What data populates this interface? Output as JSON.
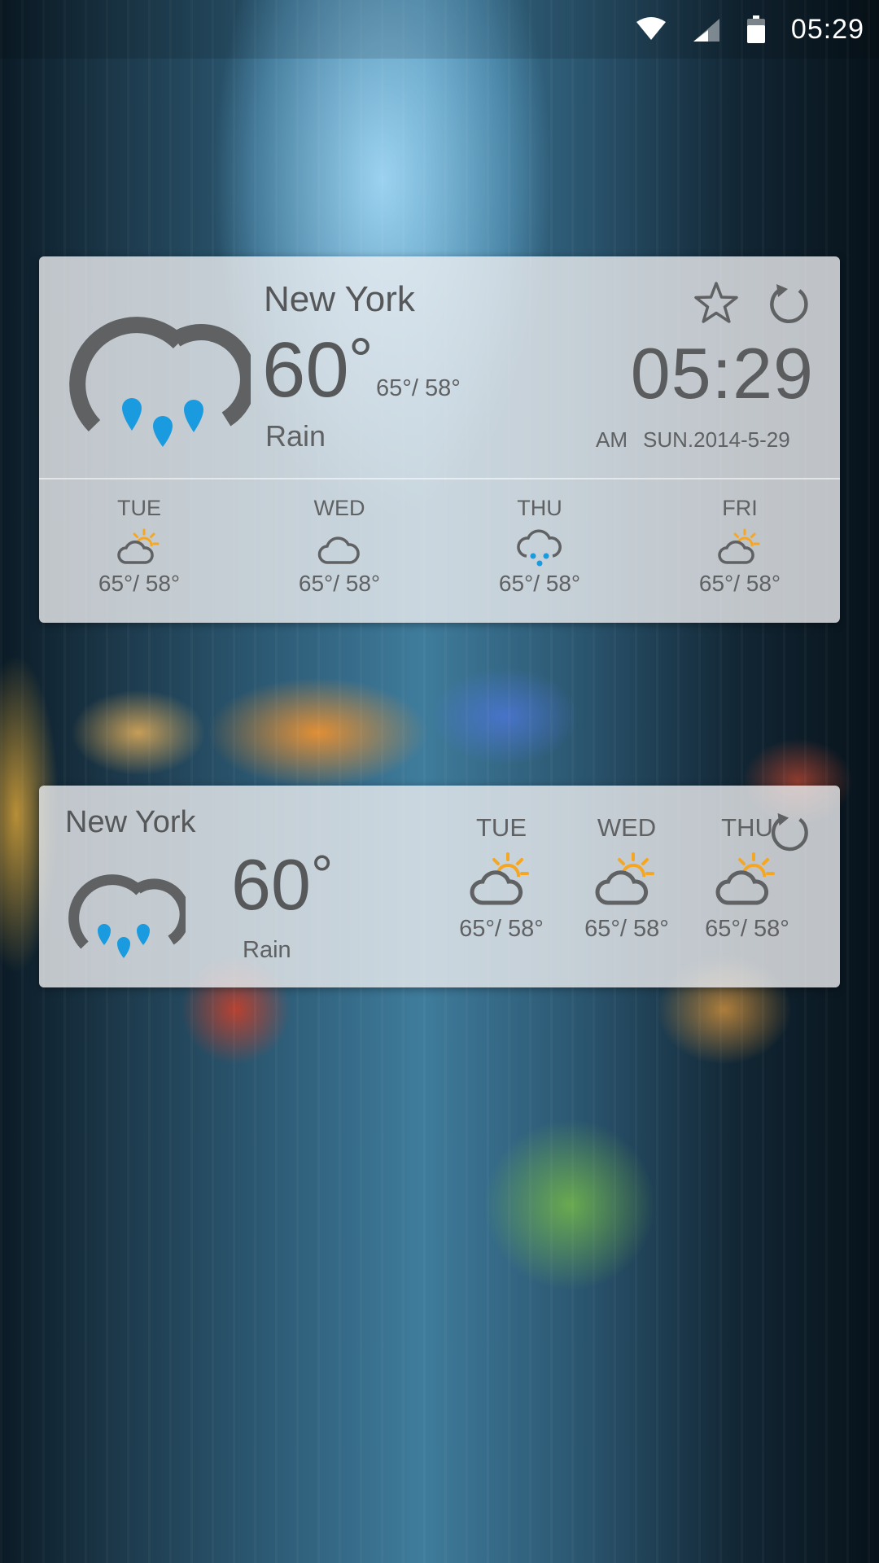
{
  "colors": {
    "text": "#5f6163",
    "icon_gray": "#5f6163",
    "rain_blue": "#1a9be0",
    "sun_yellow": "#f5a623",
    "panel": "rgba(236,238,240,0.80)"
  },
  "status_bar": {
    "time": "05:29",
    "icons": [
      "wifi-icon",
      "signal-icon",
      "battery-icon"
    ]
  },
  "large_widget": {
    "city": "New York",
    "temperature": "60",
    "degree": "°",
    "range": "65°/ 58°",
    "condition": "Rain",
    "condition_icon": "rain-cloud-icon",
    "time": "05:29",
    "ampm": "AM",
    "date": "SUN.2014-5-29",
    "actions": [
      "star-icon",
      "refresh-icon"
    ],
    "forecast": [
      {
        "day": "TUE",
        "range": "65°/ 58°",
        "icon": "partly-sunny-icon"
      },
      {
        "day": "WED",
        "range": "65°/ 58°",
        "icon": "cloudy-icon"
      },
      {
        "day": "THU",
        "range": "65°/ 58°",
        "icon": "rain-icon"
      },
      {
        "day": "FRI",
        "range": "65°/ 58°",
        "icon": "partly-sunny-icon"
      }
    ]
  },
  "small_widget": {
    "city": "New York",
    "temperature": "60",
    "degree": "°",
    "condition": "Rain",
    "condition_icon": "rain-cloud-icon",
    "actions": [
      "refresh-icon"
    ],
    "forecast": [
      {
        "day": "TUE",
        "range": "65°/ 58°",
        "icon": "partly-sunny-icon"
      },
      {
        "day": "WED",
        "range": "65°/ 58°",
        "icon": "partly-sunny-icon"
      },
      {
        "day": "THU",
        "range": "65°/ 58°",
        "icon": "partly-sunny-icon"
      }
    ]
  }
}
